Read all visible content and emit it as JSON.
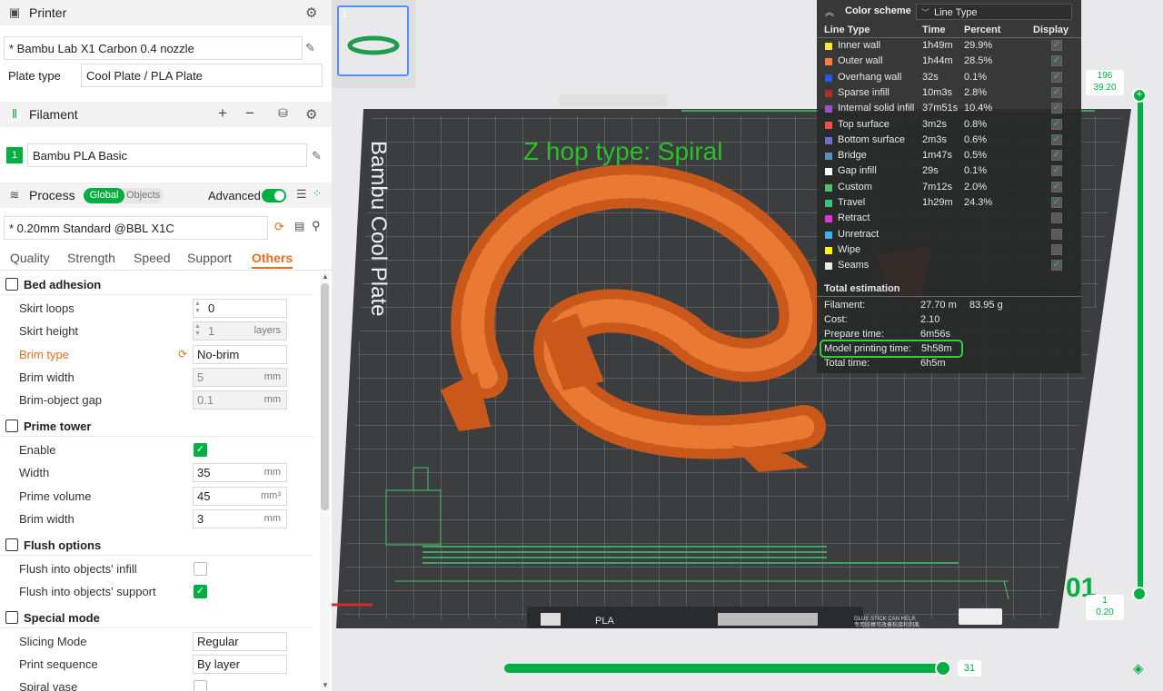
{
  "printer": {
    "header": "Printer",
    "name": "* Bambu Lab X1 Carbon 0.4 nozzle",
    "plate_type_label": "Plate type",
    "plate_type_value": "Cool Plate / PLA Plate"
  },
  "filament": {
    "header": "Filament",
    "slot_number": "1",
    "name": "Bambu PLA Basic",
    "color": "#00ae42"
  },
  "process": {
    "header": "Process",
    "toggle_global": "Global",
    "toggle_objects": "Objects",
    "advanced_label": "Advanced",
    "preset": "* 0.20mm Standard @BBL X1C",
    "tabs": [
      "Quality",
      "Strength",
      "Speed",
      "Support",
      "Others"
    ],
    "active_tab": "Others"
  },
  "settings": {
    "bed_adhesion": {
      "title": "Bed adhesion",
      "skirt_loops_label": "Skirt loops",
      "skirt_loops_value": "0",
      "skirt_height_label": "Skirt height",
      "skirt_height_value": "1",
      "skirt_height_unit": "layers",
      "brim_type_label": "Brim type",
      "brim_type_value": "No-brim",
      "brim_width_label": "Brim width",
      "brim_width_value": "5",
      "brim_width_unit": "mm",
      "brim_gap_label": "Brim-object gap",
      "brim_gap_value": "0.1",
      "brim_gap_unit": "mm"
    },
    "prime_tower": {
      "title": "Prime tower",
      "enable_label": "Enable",
      "width_label": "Width",
      "width_value": "35",
      "width_unit": "mm",
      "volume_label": "Prime volume",
      "volume_value": "45",
      "volume_unit": "mm³",
      "brim_width_label": "Brim width",
      "brim_width_value": "3",
      "brim_width_unit": "mm"
    },
    "flush_options": {
      "title": "Flush options",
      "infill_label": "Flush into objects' infill",
      "support_label": "Flush into objects' support"
    },
    "special_mode": {
      "title": "Special mode",
      "slicing_mode_label": "Slicing Mode",
      "slicing_mode_value": "Regular",
      "print_sequence_label": "Print sequence",
      "print_sequence_value": "By layer",
      "spiral_vase_label": "Spiral vase"
    }
  },
  "viewport": {
    "plate_number": "1",
    "plate_title": "Bambu Cool Plate",
    "annotation": "Z hop type: Spiral",
    "plate_footer_material": "PLA",
    "plate_footer_tip": "GLUE STICK CAN HELP.",
    "plate_footer_tip_cn": "专用胶棒可改善粘接和剥离",
    "layer_top_index": "196",
    "layer_top_height": "39.20",
    "layer_bottom_index": "1",
    "layer_bottom_height": "0.20",
    "big_layer_label": "01",
    "horizontal_slider_value": "31"
  },
  "legend": {
    "title": "Color scheme",
    "scheme": "Line Type",
    "col_headers": [
      "Line Type",
      "Time",
      "Percent",
      "Display"
    ],
    "rows": [
      {
        "name": "Inner wall",
        "time": "1h49m",
        "percent": "29.9%",
        "color": "#ffe640",
        "display": true
      },
      {
        "name": "Outer wall",
        "time": "1h44m",
        "percent": "28.5%",
        "color": "#ff7d38",
        "display": true
      },
      {
        "name": "Overhang wall",
        "time": "32s",
        "percent": "0.1%",
        "color": "#1f5fe0",
        "display": true
      },
      {
        "name": "Sparse infill",
        "time": "10m3s",
        "percent": "2.8%",
        "color": "#b03029",
        "display": true
      },
      {
        "name": "Internal solid infill",
        "time": "37m51s",
        "percent": "10.4%",
        "color": "#9654cc",
        "display": true
      },
      {
        "name": "Top surface",
        "time": "3m2s",
        "percent": "0.8%",
        "color": "#f04d4d",
        "display": true
      },
      {
        "name": "Bottom surface",
        "time": "2m3s",
        "percent": "0.6%",
        "color": "#6d6dcd",
        "display": true
      },
      {
        "name": "Bridge",
        "time": "1m47s",
        "percent": "0.5%",
        "color": "#5a8ebe",
        "display": true
      },
      {
        "name": "Gap infill",
        "time": "29s",
        "percent": "0.1%",
        "color": "#ffffff",
        "display": true
      },
      {
        "name": "Custom",
        "time": "7m12s",
        "percent": "2.0%",
        "color": "#4ec270",
        "display": true
      },
      {
        "name": "Travel",
        "time": "1h29m",
        "percent": "24.3%",
        "color": "#3ac47d",
        "display": true
      },
      {
        "name": "Retract",
        "time": "",
        "percent": "",
        "color": "#d93ad9",
        "display": false
      },
      {
        "name": "Unretract",
        "time": "",
        "percent": "",
        "color": "#35b5ea",
        "display": false
      },
      {
        "name": "Wipe",
        "time": "",
        "percent": "",
        "color": "#fff21f",
        "display": false
      },
      {
        "name": "Seams",
        "time": "",
        "percent": "",
        "color": "#eaeaea",
        "display": true
      }
    ],
    "total_title": "Total estimation",
    "filament_label": "Filament:",
    "filament_length": "27.70 m",
    "filament_weight": "83.95 g",
    "cost_label": "Cost:",
    "cost_value": "2.10",
    "prepare_label": "Prepare time:",
    "prepare_value": "6m56s",
    "model_label": "Model printing time:",
    "model_value": "5h58m",
    "total_label": "Total time:",
    "total_value": "6h5m"
  }
}
